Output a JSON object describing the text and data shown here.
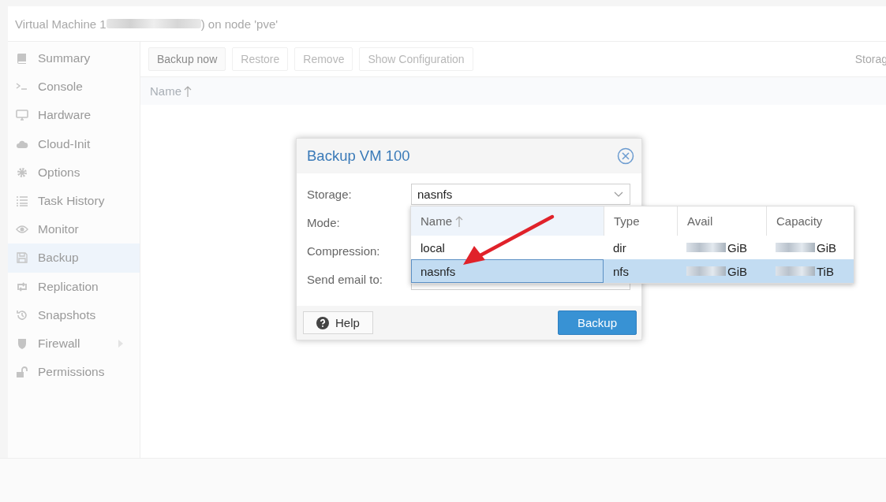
{
  "header": {
    "title_start": "Virtual Machine 1",
    "title_end": ") on node 'pve'"
  },
  "sidebar": {
    "items": [
      {
        "label": "Summary",
        "selected": false,
        "expandable": false
      },
      {
        "label": "Console",
        "selected": false,
        "expandable": false
      },
      {
        "label": "Hardware",
        "selected": false,
        "expandable": false
      },
      {
        "label": "Cloud-Init",
        "selected": false,
        "expandable": false
      },
      {
        "label": "Options",
        "selected": false,
        "expandable": false
      },
      {
        "label": "Task History",
        "selected": false,
        "expandable": false
      },
      {
        "label": "Monitor",
        "selected": false,
        "expandable": false
      },
      {
        "label": "Backup",
        "selected": true,
        "expandable": false
      },
      {
        "label": "Replication",
        "selected": false,
        "expandable": false
      },
      {
        "label": "Snapshots",
        "selected": false,
        "expandable": false
      },
      {
        "label": "Firewall",
        "selected": false,
        "expandable": true
      },
      {
        "label": "Permissions",
        "selected": false,
        "expandable": false
      }
    ]
  },
  "toolbar": {
    "buttons": [
      {
        "label": "Backup now",
        "disabled": false
      },
      {
        "label": "Restore",
        "disabled": true
      },
      {
        "label": "Remove",
        "disabled": true
      },
      {
        "label": "Show Configuration",
        "disabled": true
      }
    ],
    "storage_label": "Storag"
  },
  "grid": {
    "columns": [
      {
        "label": "Name",
        "sorted": true
      }
    ]
  },
  "dialog": {
    "title": "Backup VM 100",
    "fields": [
      {
        "label": "Storage:",
        "value": "nasnfs"
      },
      {
        "label": "Mode:"
      },
      {
        "label": "Compression:"
      },
      {
        "label": "Send email to:"
      }
    ],
    "help_button": "Help",
    "submit_button": "Backup"
  },
  "dropdown": {
    "columns": [
      {
        "label": "Name",
        "sorted": true
      },
      {
        "label": "Type",
        "sorted": false
      },
      {
        "label": "Avail",
        "sorted": false
      },
      {
        "label": "Capacity",
        "sorted": false
      }
    ],
    "rows": [
      {
        "name": "local",
        "type": "dir",
        "avail": "GiB",
        "capacity": "GiB",
        "selected": false
      },
      {
        "name": "nasnfs",
        "type": "nfs",
        "avail": "GiB",
        "capacity": "TiB",
        "selected": true
      }
    ]
  }
}
